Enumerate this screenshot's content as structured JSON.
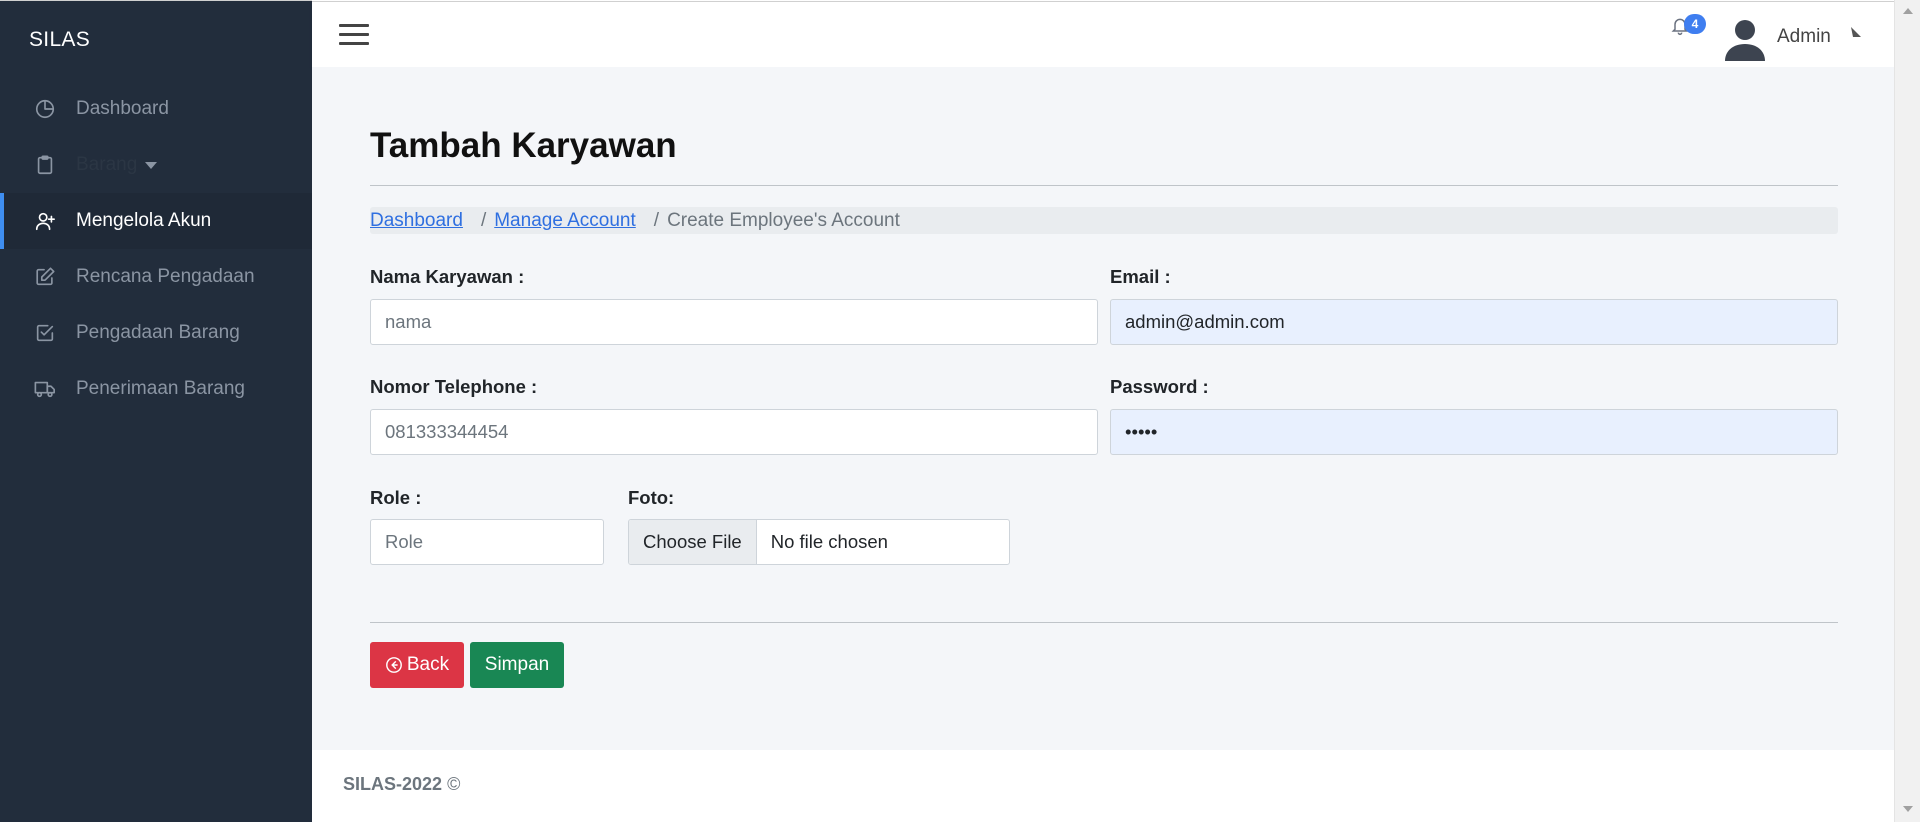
{
  "sidebar": {
    "brand": "SILAS",
    "items": [
      {
        "label": "Dashboard",
        "icon": "pie-chart-icon"
      },
      {
        "label": "Barang",
        "icon": "clipboard-icon"
      },
      {
        "label": "Mengelola Akun",
        "icon": "user-plus-icon"
      },
      {
        "label": "Rencana Pengadaan",
        "icon": "edit-icon"
      },
      {
        "label": "Pengadaan Barang",
        "icon": "check-square-icon"
      },
      {
        "label": "Penerimaan Barang",
        "icon": "truck-icon"
      }
    ]
  },
  "topbar": {
    "notification_count": "4",
    "user_name": "Admin"
  },
  "page": {
    "title": "Tambah Karyawan",
    "breadcrumb": {
      "dashboard": "Dashboard",
      "manage": "Manage Account",
      "current": "Create Employee's Account"
    }
  },
  "form": {
    "nama_label": "Nama Karyawan :",
    "nama_placeholder": "nama",
    "email_label": "Email :",
    "email_value": "admin@admin.com",
    "phone_label": "Nomor Telephone :",
    "phone_placeholder": "081333344454",
    "password_label": "Password :",
    "password_value": "•••••",
    "role_label": "Role :",
    "role_placeholder": "Role",
    "foto_label": "Foto:",
    "file_button": "Choose File",
    "file_status": "No file chosen"
  },
  "buttons": {
    "back": "Back",
    "save": "Simpan"
  },
  "footer": {
    "text": "SILAS-2022",
    "copyright": "©"
  },
  "colors": {
    "sidebar_bg": "#222d3c",
    "accent": "#3f8ef0",
    "danger": "#dc3545",
    "success": "#198754",
    "autofill_bg": "#e8f0fe"
  }
}
